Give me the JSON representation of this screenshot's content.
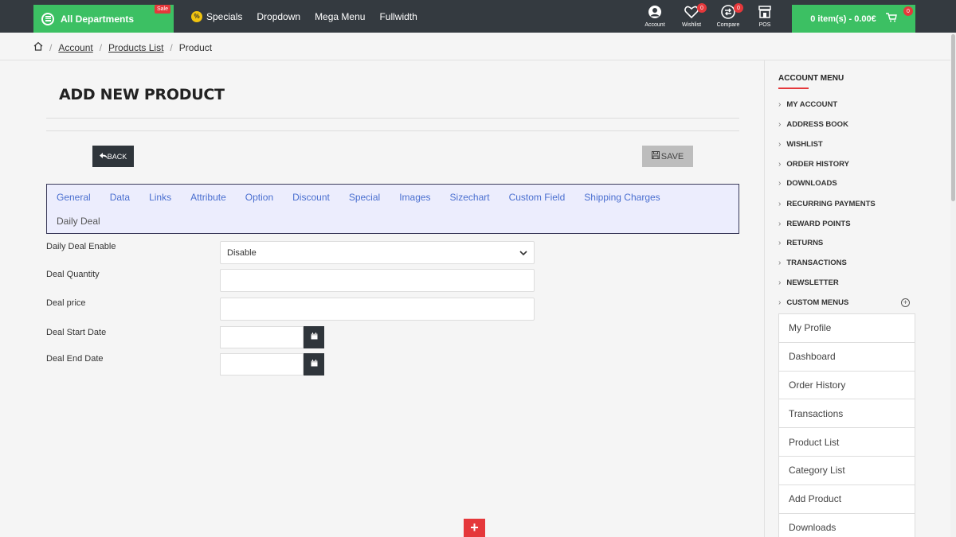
{
  "header": {
    "all_departments": "All Departments",
    "sale_badge": "Sale",
    "nav": [
      "Specials",
      "Dropdown",
      "Mega Menu",
      "Fullwidth"
    ],
    "specials_icon_text": "%",
    "icons": [
      {
        "label": "Account",
        "icon": "account-icon",
        "badge": ""
      },
      {
        "label": "Wishlist",
        "icon": "heart-icon",
        "badge": "0"
      },
      {
        "label": "Compare",
        "icon": "compare-icon",
        "badge": "0"
      },
      {
        "label": "POS",
        "icon": "store-icon",
        "badge": ""
      }
    ],
    "cart_label": "0 item(s) - 0.00€",
    "cart_badge": "0",
    "accent_color": "#3cc063",
    "badge_color": "#e5383b"
  },
  "breadcrumb": {
    "items": [
      "Account",
      "Products List",
      "Product"
    ]
  },
  "main": {
    "title": "ADD NEW PRODUCT",
    "back_label": "BACK",
    "save_label": "SAVE",
    "tabs_row1": [
      "General",
      "Data",
      "Links",
      "Attribute",
      "Option",
      "Discount",
      "Special",
      "Images",
      "Sizechart",
      "Custom Field",
      "Shipping Charges"
    ],
    "tabs_row2": [
      "Daily Deal"
    ],
    "fields": {
      "daily_deal_enable": {
        "label": "Daily Deal Enable",
        "value": "Disable"
      },
      "deal_quantity": {
        "label": "Deal Quantity",
        "value": ""
      },
      "deal_price": {
        "label": "Deal price",
        "value": ""
      },
      "deal_start_date": {
        "label": "Deal Start Date",
        "value": ""
      },
      "deal_end_date": {
        "label": "Deal End Date",
        "value": ""
      }
    },
    "plus_label": "+"
  },
  "sidebar": {
    "title": "ACCOUNT MENU",
    "items": [
      "MY ACCOUNT",
      "ADDRESS BOOK",
      "WISHLIST",
      "ORDER HISTORY",
      "DOWNLOADS",
      "RECURRING PAYMENTS",
      "REWARD POINTS",
      "RETURNS",
      "TRANSACTIONS",
      "NEWSLETTER",
      "CUSTOM MENUS"
    ],
    "custom_menu_items": [
      "My Profile",
      "Dashboard",
      "Order History",
      "Transactions",
      "Product List",
      "Category List",
      "Add Product",
      "Downloads"
    ]
  }
}
